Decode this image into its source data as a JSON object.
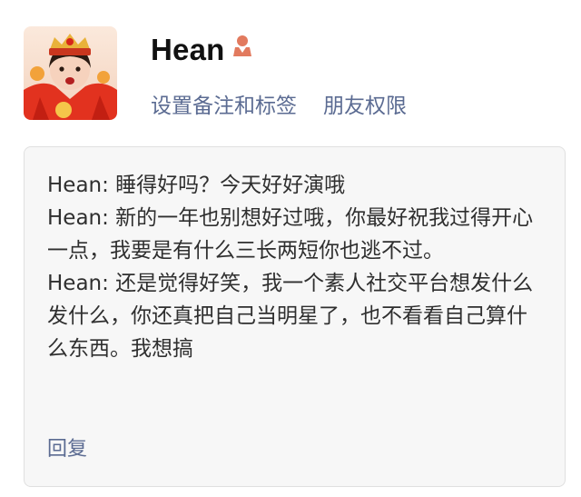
{
  "profile": {
    "name": "Hean",
    "gender_icon": "female-person-icon",
    "avatar_icon": "avatar-girl-in-red-costume"
  },
  "actions": {
    "remark_tags": "设置备注和标签",
    "friend_permissions": "朋友权限"
  },
  "messages": [
    {
      "text": "Hean: 睡得好吗？今天好好演哦"
    },
    {
      "text": "Hean: 新的一年也别想好过哦，你最好祝我过得开心一点，我要是有什么三长两短你也逃不过。"
    },
    {
      "text": "Hean: 还是觉得好笑，我一个素人社交平台想发什么发什么，你还真把自己当明星了，也不看看自己算什么东西。我想搞"
    }
  ],
  "reply_label": "回复",
  "colors": {
    "link": "#5b6b92",
    "gender_icon": "#e27a5e",
    "box_bg": "#f7f7f7"
  }
}
